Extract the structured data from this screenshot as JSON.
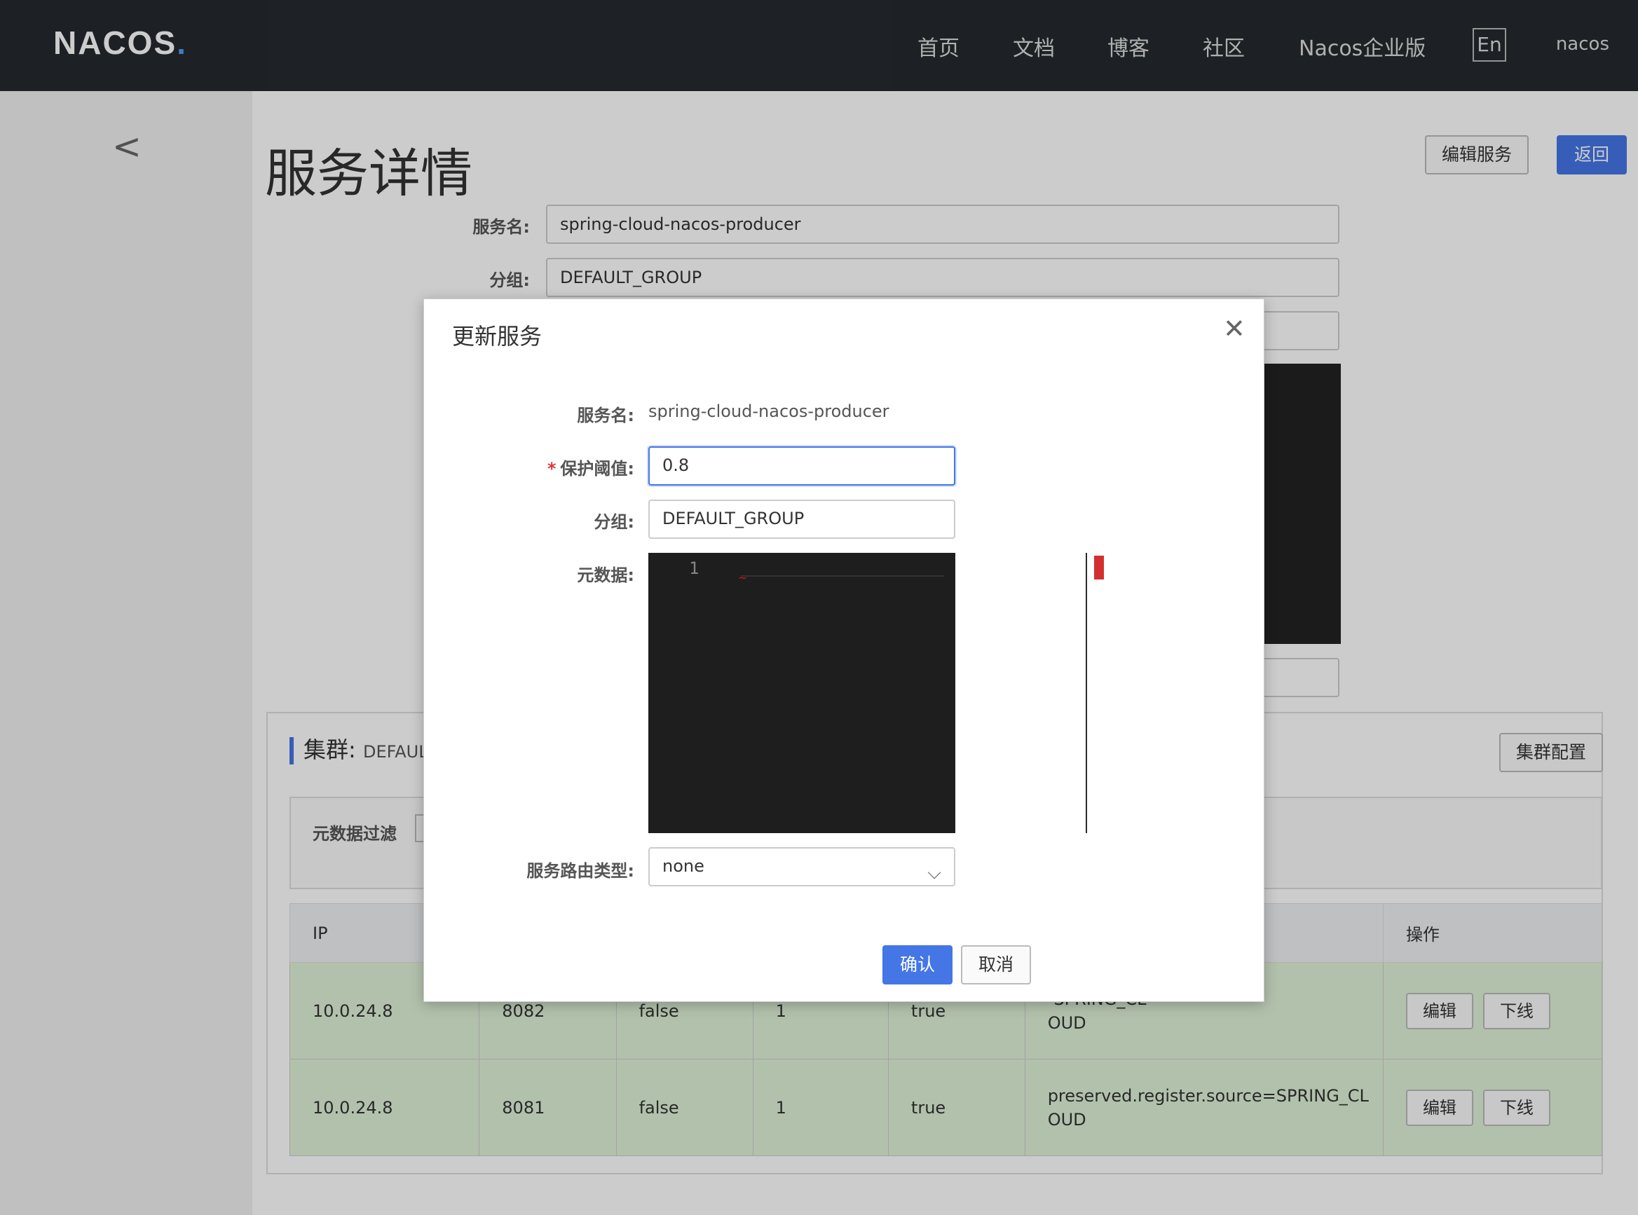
{
  "header": {
    "logo": "NACOS",
    "nav": [
      "首页",
      "文档",
      "博客",
      "社区",
      "Nacos企业版"
    ],
    "lang": "En",
    "user": "nacos"
  },
  "page": {
    "title": "服务详情",
    "edit_service_label": "编辑服务",
    "back_label": "返回",
    "fields": {
      "service_name_label": "服务名:",
      "service_name_value": "spring-cloud-nacos-producer",
      "group_label": "分组:",
      "group_value": "DEFAULT_GROUP"
    }
  },
  "cluster": {
    "title": "集群:",
    "name": "DEFAUL",
    "config_label": "集群配置",
    "filter_label": "元数据过滤",
    "table": {
      "headers": [
        "IP",
        "",
        "",
        "",
        "",
        "",
        "操作"
      ],
      "rows": [
        {
          "ip": "10.0.24.8",
          "port": "8082",
          "ephemeral": "false",
          "weight": "1",
          "healthy": "true",
          "meta1": "-SPRING_CL",
          "meta2": "OUD",
          "edit": "编辑",
          "offline": "下线"
        },
        {
          "ip": "10.0.24.8",
          "port": "8081",
          "ephemeral": "false",
          "weight": "1",
          "healthy": "true",
          "meta1": "preserved.register.source=SPRING_CL",
          "meta2": "OUD",
          "edit": "编辑",
          "offline": "下线"
        }
      ]
    }
  },
  "dialog": {
    "title": "更新服务",
    "service_name_label": "服务名:",
    "service_name_value": "spring-cloud-nacos-producer",
    "threshold_label": "保护阈值:",
    "threshold_value": "0.8",
    "group_label": "分组:",
    "group_value": "DEFAULT_GROUP",
    "metadata_label": "元数据:",
    "editor_line": "1",
    "route_label": "服务路由类型:",
    "route_value": "none",
    "confirm_label": "确认",
    "cancel_label": "取消"
  }
}
